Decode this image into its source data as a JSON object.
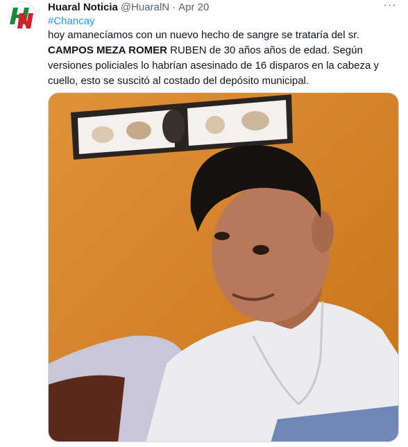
{
  "tweet": {
    "author_name": "Huaral Noticia",
    "author_handle": "@HuaralN",
    "separator": "·",
    "date": "Apr 20",
    "more_label": "···",
    "hashtag": "#Chancay",
    "text_part1": "hoy amanecíamos con un nuevo hecho de sangre se trataría del sr.",
    "text_bold": "CAMPOS MEZA ROMER",
    "text_part2": " RUBEN de 30 años años de edad. Según versiones policiales lo habrían asesinado de 16 disparos en la cabeza y cuello, esto se suscitó al costado del depósito municipal.",
    "avatar_logo_text": "HN",
    "avatar_colors": {
      "green": "#1a8a3a",
      "red": "#d3202a"
    },
    "media_icon": "photo"
  },
  "colors": {
    "text": "#0f1419",
    "secondary": "#536471",
    "link": "#1d9bf0",
    "wall": "#d9892a"
  }
}
